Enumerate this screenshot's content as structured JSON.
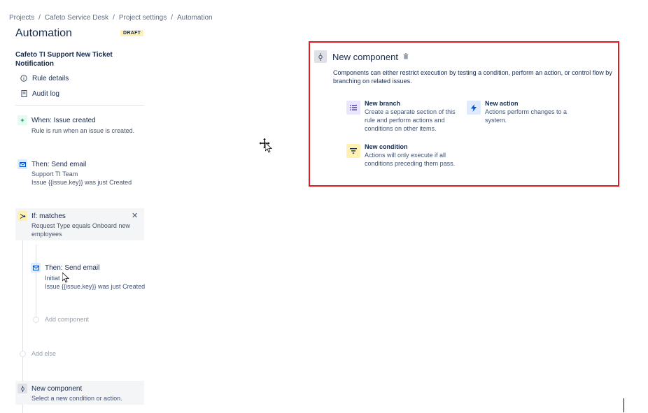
{
  "breadcrumb": [
    "Projects",
    "Cafeto Service Desk",
    "Project settings",
    "Automation"
  ],
  "page_title": "Automation",
  "status_badge": "DRAFT",
  "rule_name": "Cafeto TI Support New Ticket Notification",
  "nav": {
    "rule_details": "Rule details",
    "audit_log": "Audit log"
  },
  "steps": {
    "trigger": {
      "title": "When: Issue created",
      "desc": "Rule is run when an issue is created."
    },
    "action1": {
      "title": "Then: Send email",
      "line1": "Support TI Team",
      "line2": "Issue {{issue.key}} was just Created"
    },
    "condition": {
      "title": "If: matches",
      "desc": "Request Type equals Onboard new employees"
    },
    "action2": {
      "title": "Then: Send email",
      "line1": "Initiat",
      "line2": "Issue {{issue.key}} was just Created"
    },
    "add_component": "Add component",
    "add_else": "Add else",
    "new_component": {
      "title": "New component",
      "desc": "Select a new condition or action."
    }
  },
  "panel": {
    "title": "New component",
    "description": "Components can either restrict execution by testing a condition, perform an action, or control flow by branching on related issues.",
    "options": {
      "branch": {
        "title": "New branch",
        "desc": "Create a separate section of this rule and perform actions and conditions on other items."
      },
      "action": {
        "title": "New action",
        "desc": "Actions perform changes to a system."
      },
      "condition": {
        "title": "New condition",
        "desc": "Actions will only execute if all conditions preceding them pass."
      }
    }
  },
  "icons": {
    "trigger": "plus-icon",
    "email": "mail-icon",
    "branch_condition": "branch-icon",
    "component": "component-icon",
    "trash": "trash-icon",
    "list": "list-icon",
    "bolt": "bolt-icon",
    "filter": "filter-icon"
  },
  "colors": {
    "highlight_border": "#e01b24",
    "draft_bg": "#fff0b3",
    "trigger_green": "#00875a",
    "action_blue": "#0052cc",
    "branch_purple": "#5243aa"
  }
}
